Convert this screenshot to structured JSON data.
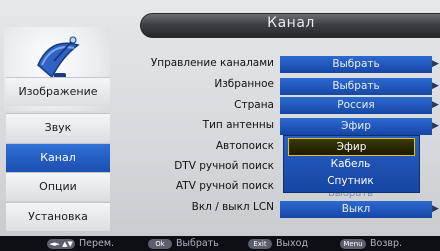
{
  "header": {
    "title": "Канал"
  },
  "sidebar": {
    "items": [
      {
        "label": "Изображение",
        "active": false
      },
      {
        "label": "Звук",
        "active": false
      },
      {
        "label": "Канал",
        "active": true
      },
      {
        "label": "Опции",
        "active": false
      },
      {
        "label": "Установка",
        "active": false
      }
    ]
  },
  "menu": {
    "rows": [
      {
        "label": "Управление каналами",
        "value": "Выбрать"
      },
      {
        "label": "Избранное",
        "value": "Выбрать"
      },
      {
        "label": "Страна",
        "value": "Россия"
      },
      {
        "label": "Тип антенны",
        "value": "Эфир"
      },
      {
        "label": "Автопоиск",
        "value": ""
      },
      {
        "label": "DTV ручной поиск",
        "value": ""
      },
      {
        "label": "ATV ручной поиск",
        "value": ""
      },
      {
        "label": "Вкл / выкл LCN",
        "value": "Выкл"
      }
    ]
  },
  "dropdown": {
    "options": [
      "Эфир",
      "Кабель",
      "Спутник"
    ],
    "selected_index": 0,
    "ghost_value": "Выбрать"
  },
  "footer": {
    "nav": {
      "key": "◄► ▲▼",
      "label": "Перем."
    },
    "ok": {
      "key": "Ok",
      "label": "Выбрать"
    },
    "exit": {
      "key": "Exit",
      "label": "Выход"
    },
    "menu": {
      "key": "Menu",
      "label": "Возвр."
    }
  },
  "colors": {
    "accent_blue": "#1b4fb0",
    "selection_border": "#f0c000"
  }
}
